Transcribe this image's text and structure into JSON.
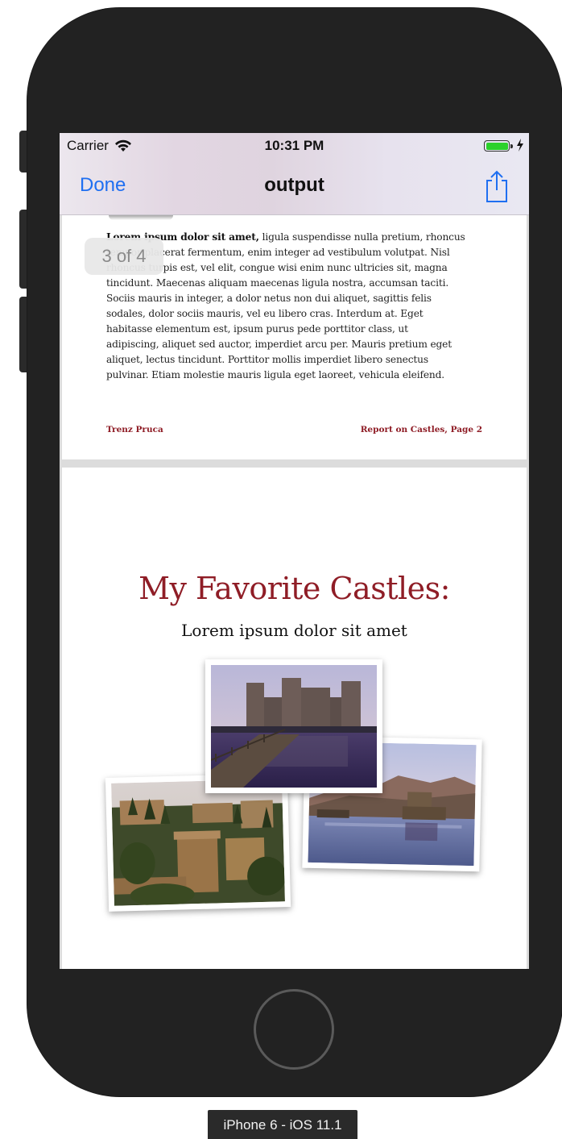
{
  "status_bar": {
    "carrier": "Carrier",
    "time": "10:31 PM",
    "battery_color": "#2bd12b",
    "wifi_icon": "wifi-icon",
    "charging_icon": "bolt-icon"
  },
  "nav": {
    "done_label": "Done",
    "title": "output",
    "share_icon": "share-icon",
    "accent_color": "#1f6ff1"
  },
  "page_indicator": "3 of 4",
  "document": {
    "page_a": {
      "lead_bold": "Lorem ipsum dolor sit amet,",
      "line1_rest": " ligula suspendisse nulla pretium, rhoncus",
      "line2": "tempor placerat fermentum, enim integer ad vestibulum volutpat. Nisl",
      "line3": "rhoncus turpis est, vel elit, congue wisi enim nunc ultricies sit, magna",
      "line4": "tincidunt. Maecenas aliquam maecenas ligula nostra, accumsan taciti.",
      "line5": "Sociis mauris in integer, a dolor netus non dui aliquet, sagittis felis",
      "line6": "sodales, dolor sociis mauris, vel eu libero cras. Interdum at. Eget",
      "line7": "habitasse elementum est, ipsum purus pede porttitor class, ut",
      "line8": "adipiscing, aliquet sed auctor, imperdiet arcu per. Mauris pretium eget",
      "line9": "aliquet, lectus tincidunt. Porttitor mollis imperdiet libero senectus",
      "line10": "pulvinar. Etiam molestie mauris ligula eget laoreet, vehicula eleifend.",
      "footer_left": "Trenz Pruca",
      "footer_right": "Report on Castles, Page 2",
      "accent_color": "#8f1d26"
    },
    "page_b": {
      "title": "My Favorite Castles:",
      "subtitle": "Lorem ipsum dolor sit amet",
      "photos": [
        "castle-moat-photo",
        "lake-castle-photo",
        "hilltop-fortress-photo"
      ]
    }
  },
  "device_label": "iPhone 6 - iOS 11.1"
}
